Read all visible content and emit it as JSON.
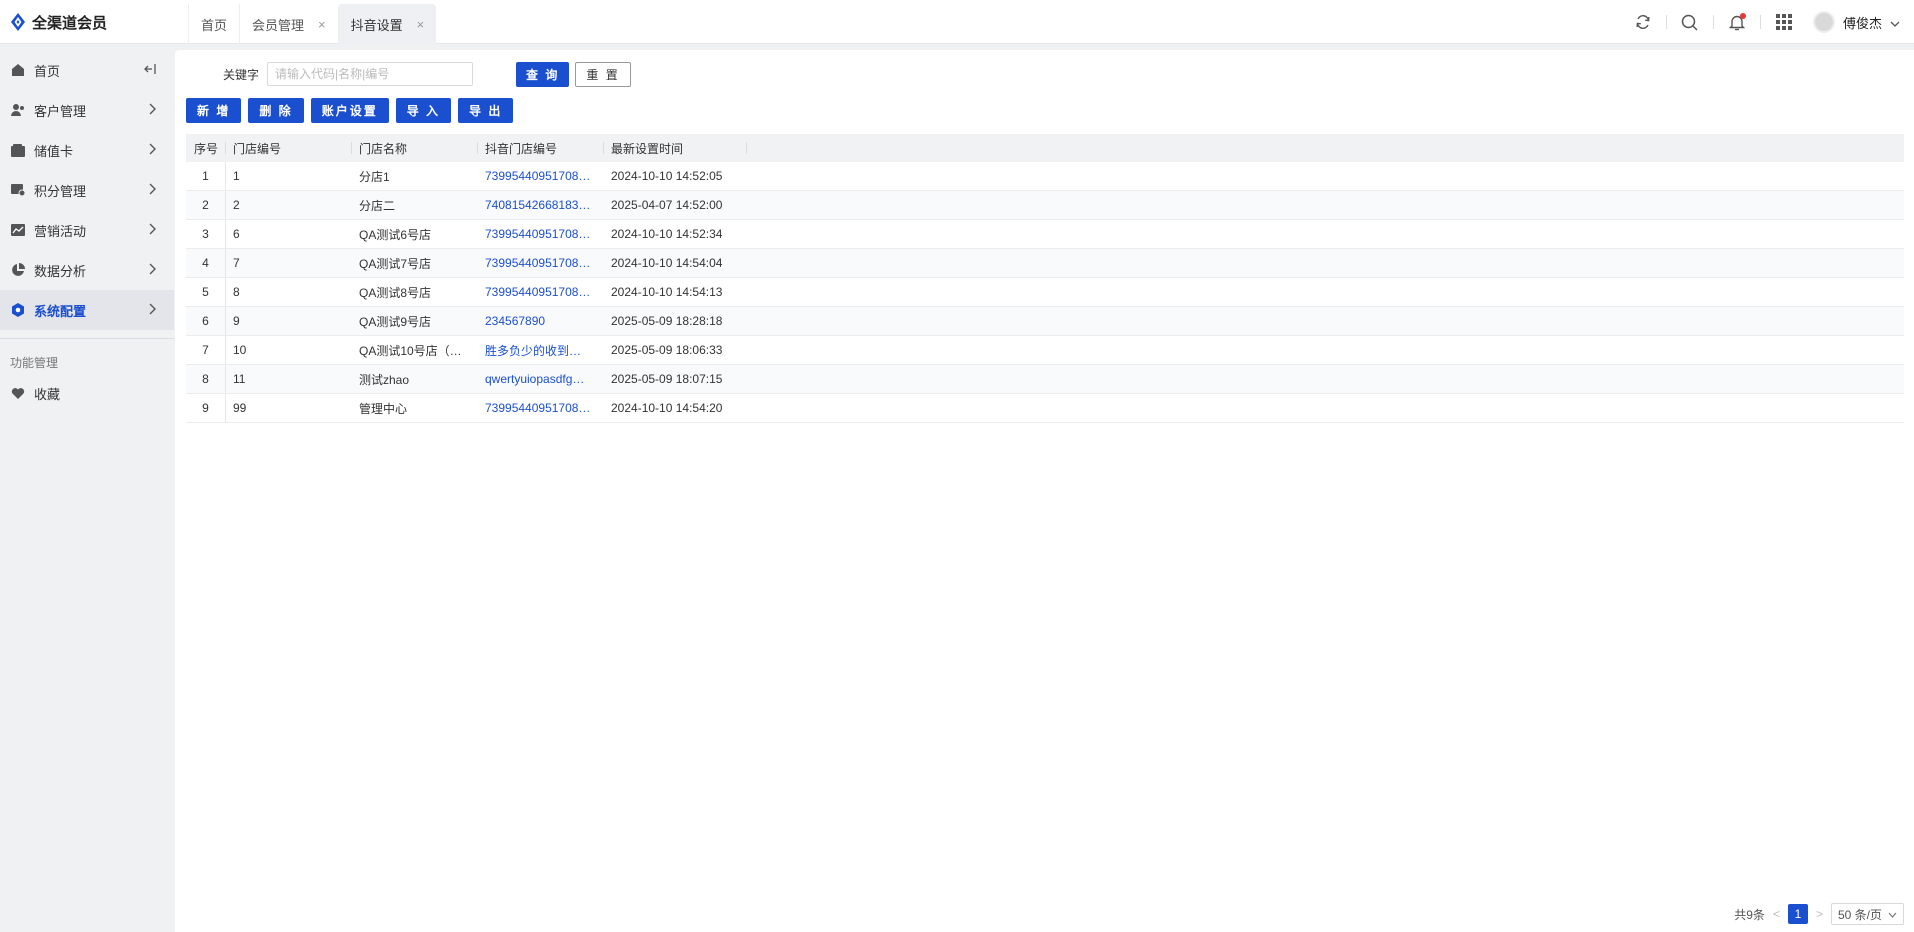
{
  "app": {
    "title": "全渠道会员"
  },
  "tabs": [
    {
      "label": "首页",
      "closable": false
    },
    {
      "label": "会员管理",
      "closable": true
    },
    {
      "label": "抖音设置",
      "closable": true,
      "active": true
    }
  ],
  "header": {
    "user_name": "傅俊杰",
    "close_glyph": "×"
  },
  "sidebar": {
    "items": [
      {
        "label": "首页",
        "icon": "home-icon"
      },
      {
        "label": "客户管理",
        "icon": "user-icon"
      },
      {
        "label": "储值卡",
        "icon": "wallet-icon"
      },
      {
        "label": "积分管理",
        "icon": "points-icon"
      },
      {
        "label": "营销活动",
        "icon": "chart-icon"
      },
      {
        "label": "数据分析",
        "icon": "pie-icon"
      },
      {
        "label": "系统配置",
        "icon": "settings-icon",
        "active": true
      }
    ],
    "group_label": "功能管理",
    "favorites_label": "收藏"
  },
  "filter": {
    "keyword_label": "关键字",
    "keyword_placeholder": "请输入代码|名称|编号",
    "keyword_value": "",
    "query_label": "查 询",
    "reset_label": "重 置"
  },
  "toolbar": {
    "add_label": "新 增",
    "delete_label": "删 除",
    "account_label": "账户设置",
    "import_label": "导 入",
    "export_label": "导 出"
  },
  "table": {
    "headers": [
      "序号",
      "门店编号",
      "门店名称",
      "抖音门店编号",
      "最新设置时间"
    ],
    "rows": [
      [
        "1",
        "1",
        "分店1",
        "73995440951708…",
        "2024-10-10 14:52:05"
      ],
      [
        "2",
        "2",
        "分店二",
        "74081542668183…",
        "2025-04-07 14:52:00"
      ],
      [
        "3",
        "6",
        "QA测试6号店",
        "73995440951708…",
        "2024-10-10 14:52:34"
      ],
      [
        "4",
        "7",
        "QA测试7号店",
        "73995440951708…",
        "2024-10-10 14:54:04"
      ],
      [
        "5",
        "8",
        "QA测试8号店",
        "73995440951708…",
        "2024-10-10 14:54:13"
      ],
      [
        "6",
        "9",
        "QA测试9号店",
        "234567890",
        "2025-05-09 18:28:18"
      ],
      [
        "7",
        "10",
        "QA测试10号店（…",
        "胜多负少的收到…",
        "2025-05-09 18:06:33"
      ],
      [
        "8",
        "11",
        "测试zhao",
        "qwertyuiopasdfg…",
        "2025-05-09 18:07:15"
      ],
      [
        "9",
        "99",
        "管理中心",
        "73995440951708…",
        "2024-10-10 14:54:20"
      ]
    ]
  },
  "pagination": {
    "total_label": "共9条",
    "current_page": "1",
    "prev": "<",
    "next": ">",
    "page_size_label": "50 条/页"
  },
  "colors": {
    "accent": "#1a4fcf",
    "notification_dot": "#e53935"
  }
}
